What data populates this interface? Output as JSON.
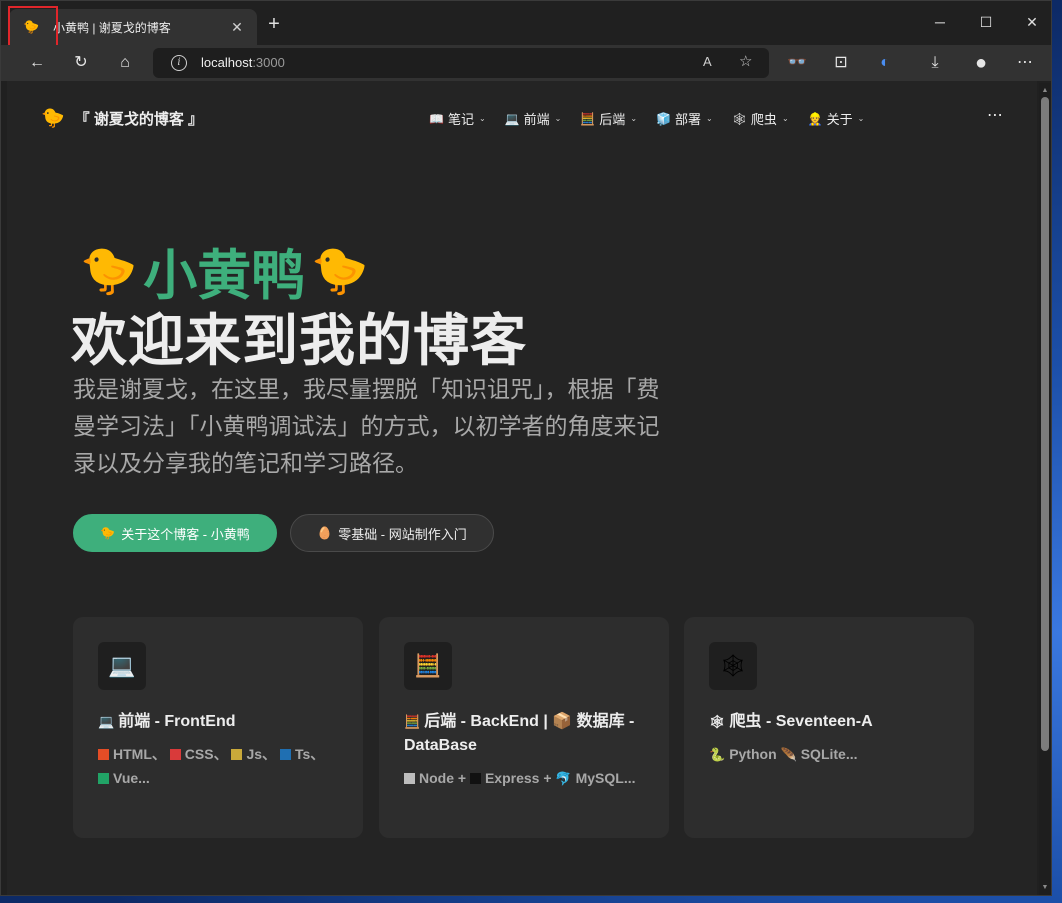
{
  "browser": {
    "tab": {
      "favicon": "🐤",
      "title": "小黄鸭 | 谢夏戈的博客",
      "close": "✕"
    },
    "newtab": "+",
    "window_controls": {
      "minimize": "─",
      "maximize": "☐",
      "close": "✕"
    },
    "toolbar": {
      "back": "←",
      "reload": "↻",
      "home": "⌂"
    },
    "address": {
      "host": "localhost",
      "port": ":3000",
      "read_aloud": "A",
      "favorite": "☆"
    },
    "extensions": {
      "ext1": "👓",
      "ext2": "⊡",
      "ext3": "◐",
      "downloads": "⤓",
      "profile": "●",
      "more": "⋯"
    }
  },
  "site": {
    "brand": {
      "logo": "🐤",
      "name": "『 谢夏戈的博客 』"
    },
    "nav": [
      {
        "icon": "📖",
        "label": "笔记"
      },
      {
        "icon": "💻",
        "label": "前端"
      },
      {
        "icon": "🧮",
        "label": "后端"
      },
      {
        "icon": "🧊",
        "label": "部署"
      },
      {
        "icon": "🕸",
        "label": "爬虫"
      },
      {
        "icon": "👷",
        "label": "关于"
      }
    ],
    "nav_chevron": "⌄",
    "nav_more": "⋯",
    "hero": {
      "chick_left": "🐤",
      "name": "小黄鸭",
      "chick_right": "🐤",
      "title": "欢迎来到我的博客",
      "description": "我是谢夏戈，在这里，我尽量摆脱「知识诅咒」，根据「费曼学习法」「小黄鸭调试法」的方式，以初学者的角度来记录以及分享我的笔记和学习路径。",
      "primary_button": {
        "icon": "🐤",
        "label": "关于这个博客 - 小黄鸭"
      },
      "secondary_button": {
        "icon": "🥚",
        "label": "零基础 - 网站制作入门"
      }
    },
    "features": [
      {
        "icon": "💻",
        "title_icon": "💻",
        "title": "前端 - FrontEnd",
        "items": [
          {
            "color": "#e44d26",
            "label": "HTML、"
          },
          {
            "color": "#d93a3a",
            "label": "CSS、"
          },
          {
            "color": "#c9a93a",
            "label": "Js、"
          },
          {
            "color": "#1f6fb2",
            "label": "Ts、"
          },
          {
            "color": "#21a366",
            "label": "Vue..."
          }
        ]
      },
      {
        "icon": "🧮",
        "title_icon": "🧮",
        "title": "后端 - BackEnd | 📦 数据库 - DataBase",
        "items": [
          {
            "color": "#bdbdbd",
            "label": "Node + "
          },
          {
            "color": "#111111",
            "label": "Express + "
          },
          {
            "color": "",
            "icon": "🐬",
            "label": "MySQL..."
          }
        ]
      },
      {
        "icon": "🕸",
        "title_icon": "🕸",
        "title": "爬虫 - Seventeen-A",
        "items": [
          {
            "color": "",
            "icon": "🐍",
            "label": "Python "
          },
          {
            "color": "",
            "icon": "🪶",
            "label": "SQLite..."
          }
        ]
      }
    ]
  }
}
